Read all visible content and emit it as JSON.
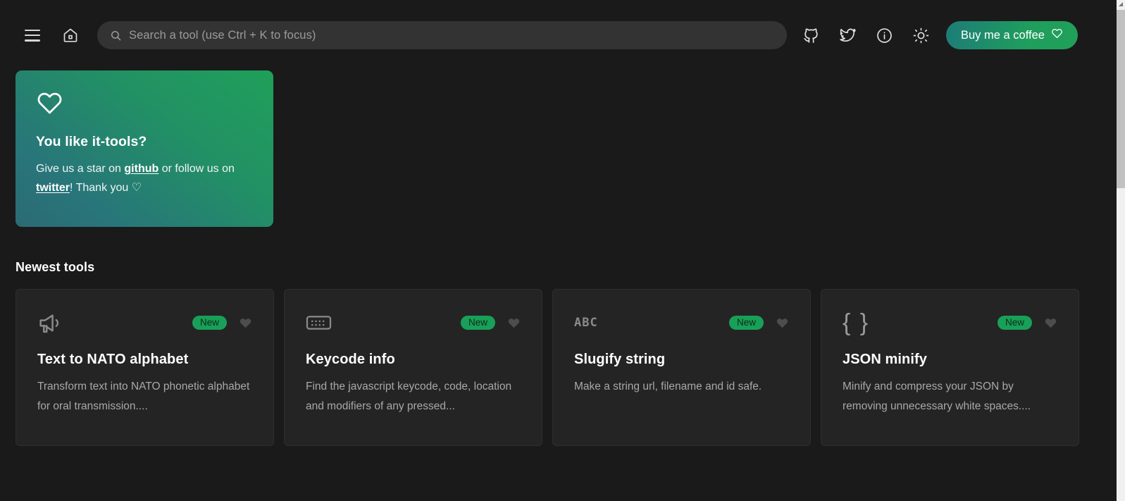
{
  "header": {
    "menu_icon": "hamburger-menu-icon",
    "home_icon": "home-icon",
    "search": {
      "placeholder": "Search a tool (use Ctrl + K to focus)",
      "value": "",
      "icon": "search-icon"
    },
    "icons": [
      {
        "name": "github-icon",
        "label": "GitHub"
      },
      {
        "name": "twitter-icon",
        "label": "Twitter"
      },
      {
        "name": "info-circle-icon",
        "label": "About"
      },
      {
        "name": "sun-icon",
        "label": "Toggle theme"
      }
    ],
    "coffee_button": {
      "label": "Buy me a coffee",
      "icon": "heart-outline-icon",
      "gradient_from": "#1d7c78",
      "gradient_to": "#20a05a"
    }
  },
  "promo": {
    "icon": "heart-outline-icon",
    "title": "You like it-tools?",
    "text_before_github": "Give us a star on ",
    "github_link": "github",
    "text_between": " or follow us on ",
    "twitter_link": "twitter",
    "text_after": "! Thank you ",
    "heart_glyph": "♡",
    "gradient_from": "#2c6a74",
    "gradient_to": "#1fa059"
  },
  "newest_tools": {
    "section_title": "Newest tools",
    "badge_label": "New",
    "badge_color": "#18a058",
    "cards": [
      {
        "icon": "megaphone-icon",
        "title": "Text to NATO alphabet",
        "description": "Transform text into NATO phonetic alphabet for oral transmission....",
        "badge": "New",
        "favorite_icon": "heart-filled-icon"
      },
      {
        "icon": "keyboard-icon",
        "title": "Keycode info",
        "description": "Find the javascript keycode, code, location and modifiers of any pressed...",
        "badge": "New",
        "favorite_icon": "heart-filled-icon"
      },
      {
        "icon": "abc-text-icon",
        "icon_text": "ABC",
        "title": "Slugify string",
        "description": "Make a string url, filename and id safe.",
        "badge": "New",
        "favorite_icon": "heart-filled-icon"
      },
      {
        "icon": "curly-braces-icon",
        "icon_text": "{ }",
        "title": "JSON minify",
        "description": "Minify and compress your JSON by removing unnecessary white spaces....",
        "badge": "New",
        "favorite_icon": "heart-filled-icon"
      }
    ]
  },
  "scrollbar": {
    "name": "vertical-scrollbar"
  }
}
